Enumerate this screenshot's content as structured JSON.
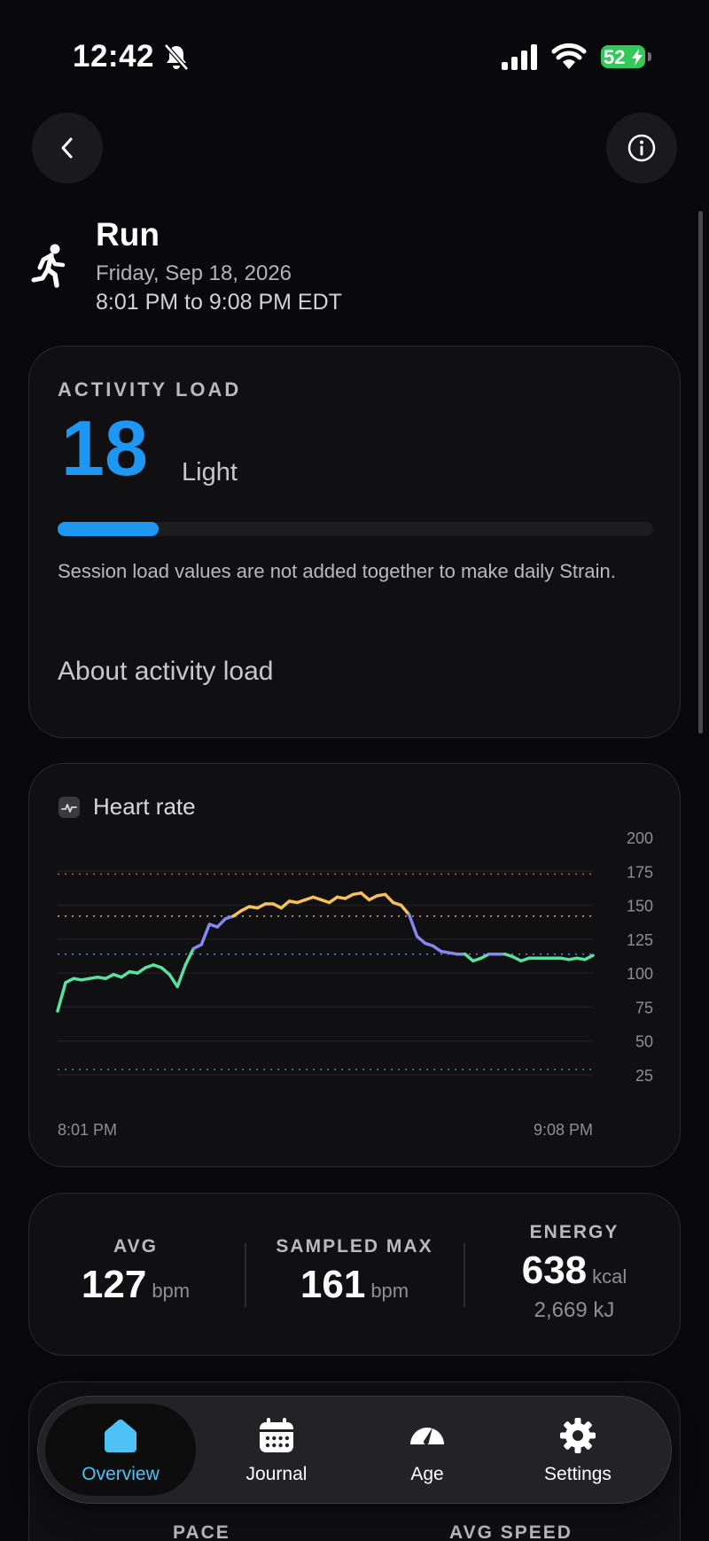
{
  "status": {
    "time": "12:42",
    "battery": "52"
  },
  "header": {
    "back_icon": "chevron-left-icon",
    "info_icon": "info-icon"
  },
  "activity": {
    "icon": "runner-icon",
    "title": "Run",
    "date": "Friday, Sep 18, 2026",
    "time_range": "8:01 PM to 9:08 PM EDT"
  },
  "activity_load": {
    "label": "ACTIVITY LOAD",
    "value": "18",
    "level": "Light",
    "progress": 0.17,
    "note": "Session load values are not added together to make daily Strain.",
    "link": "About activity load",
    "accent_color": "#1e97f3"
  },
  "heart_rate": {
    "title": "Heart rate",
    "start_label": "8:01 PM",
    "end_label": "9:08 PM"
  },
  "chart_data": {
    "type": "line",
    "title": "Heart rate",
    "ylim": [
      25,
      200
    ],
    "y_ticks": [
      "200",
      "175",
      "150",
      "125",
      "100",
      "75",
      "50",
      "25"
    ],
    "x_start": "8:01 PM",
    "x_end": "9:08 PM",
    "zone_lines": [
      {
        "value": 173,
        "color": "#d0504c"
      },
      {
        "value": 142,
        "color": "#c9a33a"
      },
      {
        "value": 114,
        "color": "#7377d6"
      },
      {
        "value": 29,
        "color": "#2f9e78"
      }
    ],
    "zone_colors": [
      {
        "min": 0,
        "max": 114,
        "color": "#5be0a0"
      },
      {
        "min": 114,
        "max": 142,
        "color": "#8488f2"
      },
      {
        "min": 142,
        "max": 200,
        "color": "#f6c05c"
      }
    ],
    "series": [
      {
        "x": [
          0,
          1,
          2,
          3,
          4,
          5,
          6,
          7,
          8,
          9,
          10,
          11,
          12,
          13,
          14,
          15,
          16,
          17,
          18,
          19,
          20,
          21,
          22,
          23,
          24,
          25,
          26,
          27,
          28,
          29,
          30,
          31,
          32,
          33,
          34,
          35,
          36,
          37,
          38,
          39,
          40,
          41,
          42,
          43,
          44,
          45,
          46,
          47,
          48,
          49,
          50,
          51,
          52,
          53,
          54,
          55,
          56,
          57,
          58,
          59,
          60,
          61,
          62,
          63,
          64,
          65,
          66,
          67
        ],
        "y": [
          72,
          93,
          96,
          95,
          96,
          97,
          96,
          99,
          97,
          101,
          100,
          104,
          106,
          104,
          99,
          90,
          106,
          118,
          121,
          136,
          134,
          140,
          142,
          146,
          149,
          148,
          151,
          151,
          148,
          153,
          152,
          154,
          156,
          154,
          152,
          156,
          155,
          158,
          159,
          154,
          157,
          158,
          152,
          150,
          143,
          127,
          122,
          120,
          116,
          115,
          114,
          114,
          109,
          111,
          114,
          114,
          114,
          112,
          109,
          111,
          111,
          111,
          111,
          111,
          110,
          111,
          110,
          113
        ]
      }
    ]
  },
  "stats": {
    "avg": {
      "label": "AVG",
      "value": "127",
      "unit": "bpm"
    },
    "max": {
      "label": "SAMPLED MAX",
      "value": "161",
      "unit": "bpm"
    },
    "energy": {
      "label": "ENERGY",
      "value": "638",
      "unit": "kcal",
      "sub": "2,669 kJ"
    }
  },
  "pace": {
    "pace_label": "PACE",
    "speed_label": "AVG SPEED"
  },
  "tabs": [
    {
      "label": "Overview",
      "icon": "home-icon",
      "active": true
    },
    {
      "label": "Journal",
      "icon": "calendar-icon",
      "active": false
    },
    {
      "label": "Age",
      "icon": "gauge-icon",
      "active": false
    },
    {
      "label": "Settings",
      "icon": "gear-icon",
      "active": false
    }
  ]
}
